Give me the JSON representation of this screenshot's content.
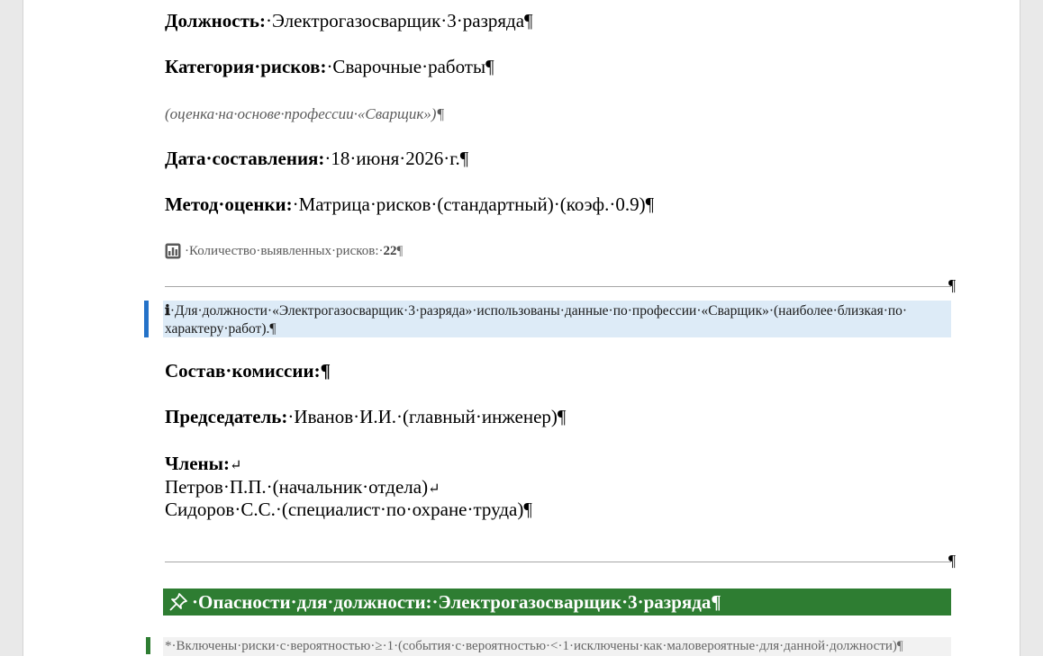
{
  "position": {
    "label": "Должность:",
    "value": "·Электрогазосварщик·3·разряда¶"
  },
  "risk_category": {
    "label": "Категория·рисков:",
    "value": "·Сварочные·работы¶"
  },
  "assessment_note": "(оценка·на·основе·профессии·«Сварщик»)¶",
  "date": {
    "label": "Дата·составления:",
    "value": "·18·июня·2026·г.¶"
  },
  "method": {
    "label": "Метод·оценки:",
    "value": "·Матрица·рисков·(стандартный)·(коэф.·0.9)¶"
  },
  "risk_count": {
    "label": "·Количество·выявленных·рисков:·",
    "value": "22",
    "mark": "¶",
    "icon": "bar-chart-icon"
  },
  "hr_mark": "¶",
  "info": {
    "icon_glyph": "ℹ",
    "line1": "·Для·должности·«Электрогазосварщик·3·разряда»·использованы·данные·по·профессии·«Сварщик»·(наиболее·близкая·по·",
    "line2": "характеру·работ).¶"
  },
  "commission": {
    "title": "Состав·комиссии:¶"
  },
  "chairman": {
    "label": "Председатель:",
    "value": "·Иванов·И.И.·(главный·инженер)¶"
  },
  "members": {
    "label": "Члены:",
    "return_mark": "↵",
    "items": [
      "Петров·П.П.·(начальник·отдела)",
      "Сидоров·С.С.·(специалист·по·охране·труда)¶"
    ]
  },
  "hazards_heading": {
    "text": "·Опасности·для·должности:·Электрогазосварщик·3·разряда¶",
    "icon": "pin-icon"
  },
  "footnote": "*·Включены·риски·с·вероятностью·≥·1·(события·с·вероятностью·<·1·исключены·как·маловероятные·для·данной·должности)¶",
  "colors": {
    "accent_blue": "#2472c8",
    "info_bg": "#ddebf7",
    "green": "#2e7d32"
  }
}
